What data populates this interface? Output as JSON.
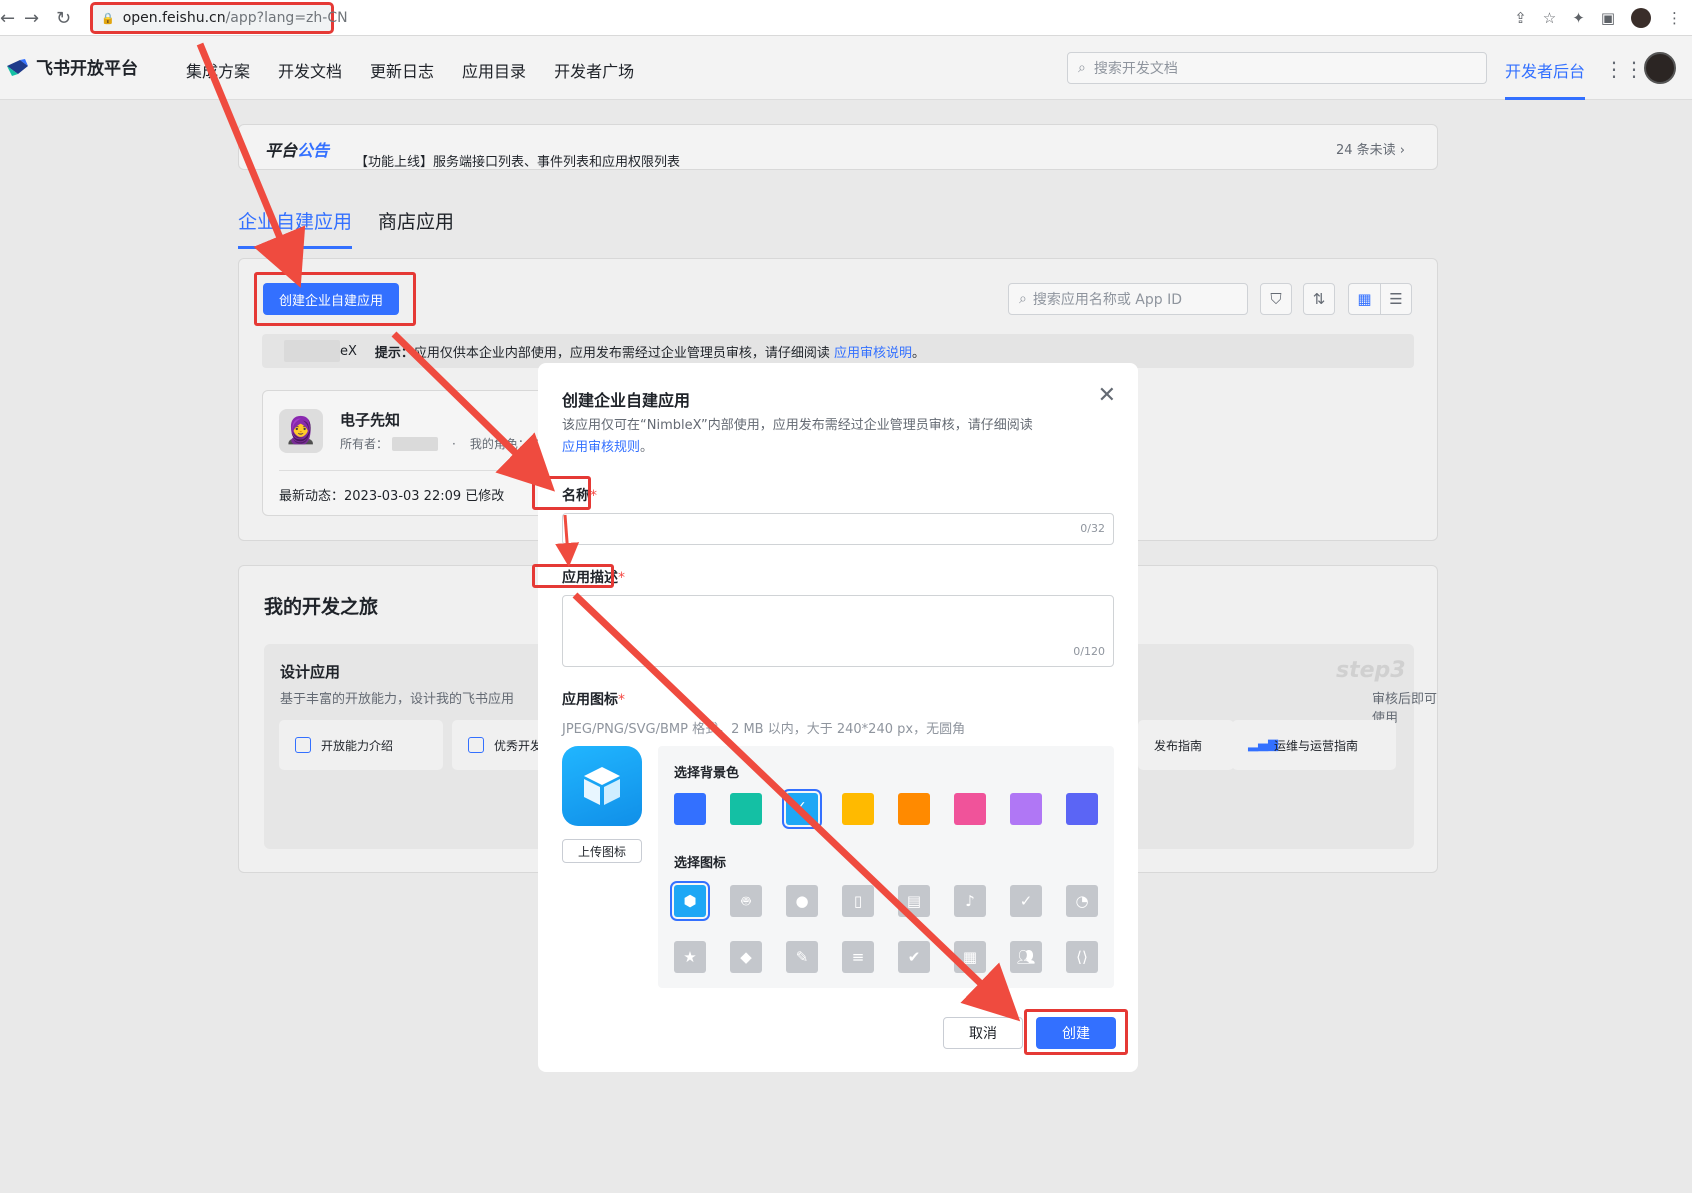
{
  "browser": {
    "url_host": "open.feishu.cn",
    "url_path": "/app?lang=zh-CN"
  },
  "topnav": {
    "logo": "飞书开放平台",
    "links": [
      "集成方案",
      "开发文档",
      "更新日志",
      "应用目录",
      "开发者广场"
    ],
    "search_placeholder": "搜索开发文档",
    "dev_console": "开发者后台"
  },
  "announcement": {
    "title_a": "平台",
    "title_b": "公告",
    "text": "【功能上线】服务端接口列表、事件列表和应用权限列表",
    "more": "24 条未读 ›"
  },
  "tabs": [
    "企业自建应用",
    "商店应用"
  ],
  "apps": {
    "create_button": "创建企业自建应用",
    "search_placeholder": "搜索应用名称或 App ID",
    "tip_suffix": "eX",
    "tip_label": "提示：",
    "tip_text": "应用仅供本企业内部使用，应用发布需经过企业管理员审核，请仔细阅读",
    "tip_link": "应用审核说明",
    "tip_end": "。",
    "card": {
      "name": "电子先知",
      "owner_label": "所有者：",
      "role_label": "我的角色：户",
      "activity": "最新动态：2023-03-03 22:09  已修改"
    }
  },
  "journey": {
    "title": "我的开发之旅",
    "step1_title": "设计应用",
    "step1_desc": "基于丰富的开放能力，设计我的飞书应用",
    "step3_desc": "审核后即可使用",
    "step3_badge": "step3",
    "chips": [
      "开放能力介绍",
      "优秀开发",
      "发布指南",
      "运维与运营指南"
    ]
  },
  "modal": {
    "title": "创建企业自建应用",
    "desc": "该应用仅可在“NimbleX”内部使用，应用发布需经过企业管理员审核，请仔细阅读",
    "desc_link": "应用审核规则",
    "desc_end": "。",
    "name_label": "名称",
    "name_counter": "0/32",
    "desc_label": "应用描述",
    "desc_counter": "0/120",
    "icon_label": "应用图标",
    "icon_hint": "JPEG/PNG/SVG/BMP 格式，2 MB 以内，大于 240*240 px，无圆角",
    "upload": "上传图标",
    "bg_label": "选择背景色",
    "icon_pick_label": "选择图标",
    "bg_colors": [
      "#3370ff",
      "#14c0a4",
      "#1ea7f5",
      "#ffba00",
      "#ff8a00",
      "#f0539a",
      "#b077f5",
      "#5b65f5"
    ],
    "icons": [
      "cube-icon",
      "robot-icon",
      "bulb-icon",
      "door-icon",
      "briefcase-icon",
      "bell-icon",
      "bookmark-icon",
      "chart-pie-icon",
      "star-icon",
      "tag-icon",
      "wrench-icon",
      "document-icon",
      "shield-icon",
      "table-icon",
      "people-icon",
      "code-icon"
    ],
    "cancel": "取消",
    "create": "创建"
  }
}
